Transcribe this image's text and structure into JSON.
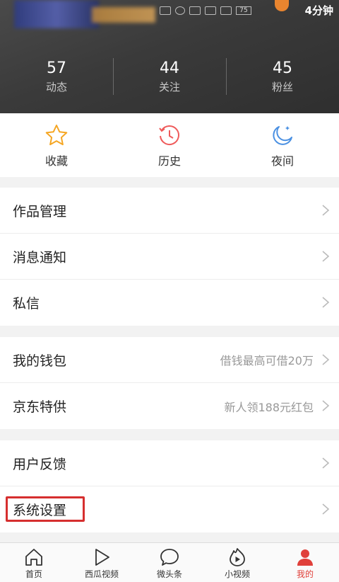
{
  "status_bar": {
    "time": "4分钟",
    "battery": "75"
  },
  "stats": [
    {
      "value": "57",
      "label": "动态"
    },
    {
      "value": "44",
      "label": "关注"
    },
    {
      "value": "45",
      "label": "粉丝"
    }
  ],
  "quick_actions": [
    {
      "label": "收藏",
      "icon": "star-icon",
      "color": "#f5a623"
    },
    {
      "label": "历史",
      "icon": "history-clock-icon",
      "color": "#ef5b5b"
    },
    {
      "label": "夜间",
      "icon": "moon-icon",
      "color": "#4a90e2"
    }
  ],
  "menu": {
    "group1": [
      {
        "label": "作品管理"
      },
      {
        "label": "消息通知"
      },
      {
        "label": "私信"
      }
    ],
    "group2": [
      {
        "label": "我的钱包",
        "hint": "借钱最高可借20万"
      },
      {
        "label": "京东特供",
        "hint": "新人领188元红包"
      }
    ],
    "group3": [
      {
        "label": "用户反馈"
      },
      {
        "label": "系统设置"
      }
    ]
  },
  "bottom_nav": [
    {
      "label": "首页",
      "icon": "home-icon"
    },
    {
      "label": "西瓜视频",
      "icon": "play-icon"
    },
    {
      "label": "微头条",
      "icon": "chat-bubble-icon"
    },
    {
      "label": "小视频",
      "icon": "flame-play-icon"
    },
    {
      "label": "我的",
      "icon": "user-icon",
      "active": true
    }
  ],
  "colors": {
    "active_tab": "#e0403a",
    "highlight_box": "#d62f2f"
  }
}
